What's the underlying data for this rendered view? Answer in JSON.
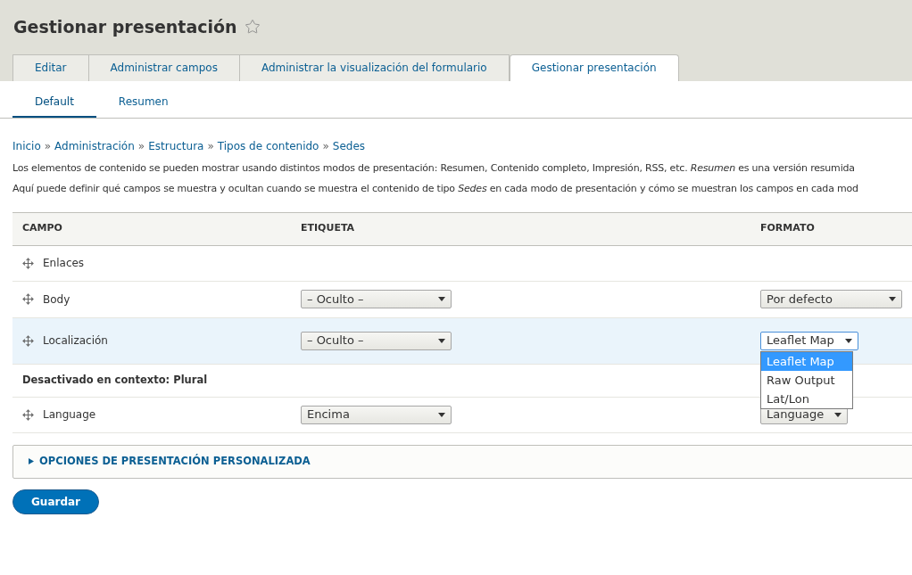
{
  "title": "Gestionar presentación",
  "tabs": [
    {
      "label": "Editar",
      "selected": false
    },
    {
      "label": "Administrar campos",
      "selected": false
    },
    {
      "label": "Administrar la visualización del formulario",
      "selected": false
    },
    {
      "label": "Gestionar presentación",
      "selected": true
    }
  ],
  "subtabs": [
    {
      "label": "Default",
      "selected": true
    },
    {
      "label": "Resumen",
      "selected": false
    }
  ],
  "breadcrumb": [
    {
      "label": "Inicio"
    },
    {
      "separator": "»",
      "label": "Administración"
    },
    {
      "separator": "»",
      "label": "Estructura"
    },
    {
      "separator": "»",
      "label": "Tipos de contenido"
    },
    {
      "separator": "»",
      "label": "Sedes"
    }
  ],
  "descriptions": [
    "Los elementos de contenido se pueden mostrar usando distintos modos de presentación: Resumen, Contenido completo, Impresión, RSS, etc. *Resumen* es una versión resumida",
    "Aquí puede definir qué campos se muestra y ocultan cuando se muestra el contenido de tipo *Sedes* en cada modo de presentación y cómo se muestran los campos en cada mod"
  ],
  "table": {
    "columns": [
      "CAMPO",
      "ETIQUETA",
      "FORMATO"
    ],
    "rows": [
      {
        "kind": "field",
        "name": "Enlaces",
        "highlighted": false
      },
      {
        "kind": "field",
        "name": "Body",
        "highlighted": false,
        "label": "– Oculto –",
        "format": "Por defecto"
      },
      {
        "kind": "field",
        "name": "Localización",
        "highlighted": true,
        "label": "– Oculto –",
        "format": "Leaflet Map",
        "open": true,
        "options": [
          {
            "label": "Leaflet Map",
            "selected": true
          },
          {
            "label": "Raw Output",
            "selected": false
          },
          {
            "label": "Lat/Lon",
            "selected": false
          }
        ]
      },
      {
        "kind": "section",
        "text": "Desactivado en contexto: Plural"
      },
      {
        "kind": "field",
        "name": "Language",
        "highlighted": false,
        "label": "Encima",
        "format": "Language"
      }
    ]
  },
  "details": {
    "summary": "OPCIONES DE PRESENTACIÓN PERSONALIZADA",
    "expanded": false
  },
  "save_button": "Guardar"
}
